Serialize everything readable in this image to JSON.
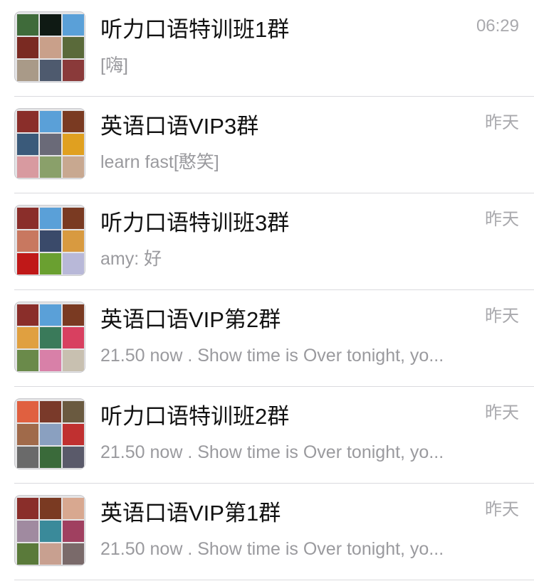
{
  "chats": [
    {
      "name": "听力口语特训班1群",
      "preview": "[嗨]",
      "time": "06:29",
      "avatar_tiles": [
        "#3f6b3a",
        "#0f1a14",
        "#5aa0d8",
        "#7a2a22",
        "#c9a08a",
        "#5a6a3a",
        "#a99a88",
        "#4e5a6e",
        "#8a3a3a"
      ]
    },
    {
      "name": "英语口语VIP3群",
      "preview": "learn fast[憨笑]",
      "time": "昨天",
      "avatar_tiles": [
        "#8a2e2a",
        "#5aa0d8",
        "#7a3a22",
        "#3a5a7a",
        "#6a6a78",
        "#e0a020",
        "#d89aa0",
        "#8aa06a",
        "#c8a890"
      ]
    },
    {
      "name": "听力口语特训班3群",
      "preview": "amy: 好",
      "time": "昨天",
      "avatar_tiles": [
        "#8a2e2a",
        "#5aa0d8",
        "#7a3a22",
        "#c87860",
        "#3a4a6a",
        "#d89a40",
        "#c01818",
        "#6aa030",
        "#b8b8d8"
      ]
    },
    {
      "name": "英语口语VIP第2群",
      "preview": "21.50 now . Show time is Over tonight, yo...",
      "time": "昨天",
      "avatar_tiles": [
        "#8a2e2a",
        "#5aa0d8",
        "#7a3a22",
        "#e0a040",
        "#3a7a5a",
        "#d84060",
        "#6a8a4a",
        "#d880a8",
        "#c8c0b0"
      ]
    },
    {
      "name": "听力口语特训班2群",
      "preview": "21.50 now . Show time is Over tonight, yo...",
      "time": "昨天",
      "avatar_tiles": [
        "#e06040",
        "#7a3a2a",
        "#6a5a40",
        "#a06a4a",
        "#8aa0c0",
        "#c03030",
        "#6a6a6a",
        "#3a6a3a",
        "#5a5a6a"
      ]
    },
    {
      "name": "英语口语VIP第1群",
      "preview": "21.50 now . Show time is Over tonight, yo...",
      "time": "昨天",
      "avatar_tiles": [
        "#8a2e2a",
        "#7a3a22",
        "#d8a890",
        "#a08aa0",
        "#3a8a9a",
        "#a04060",
        "#5a7a3a",
        "#c8a090",
        "#7a6a6a"
      ]
    }
  ]
}
